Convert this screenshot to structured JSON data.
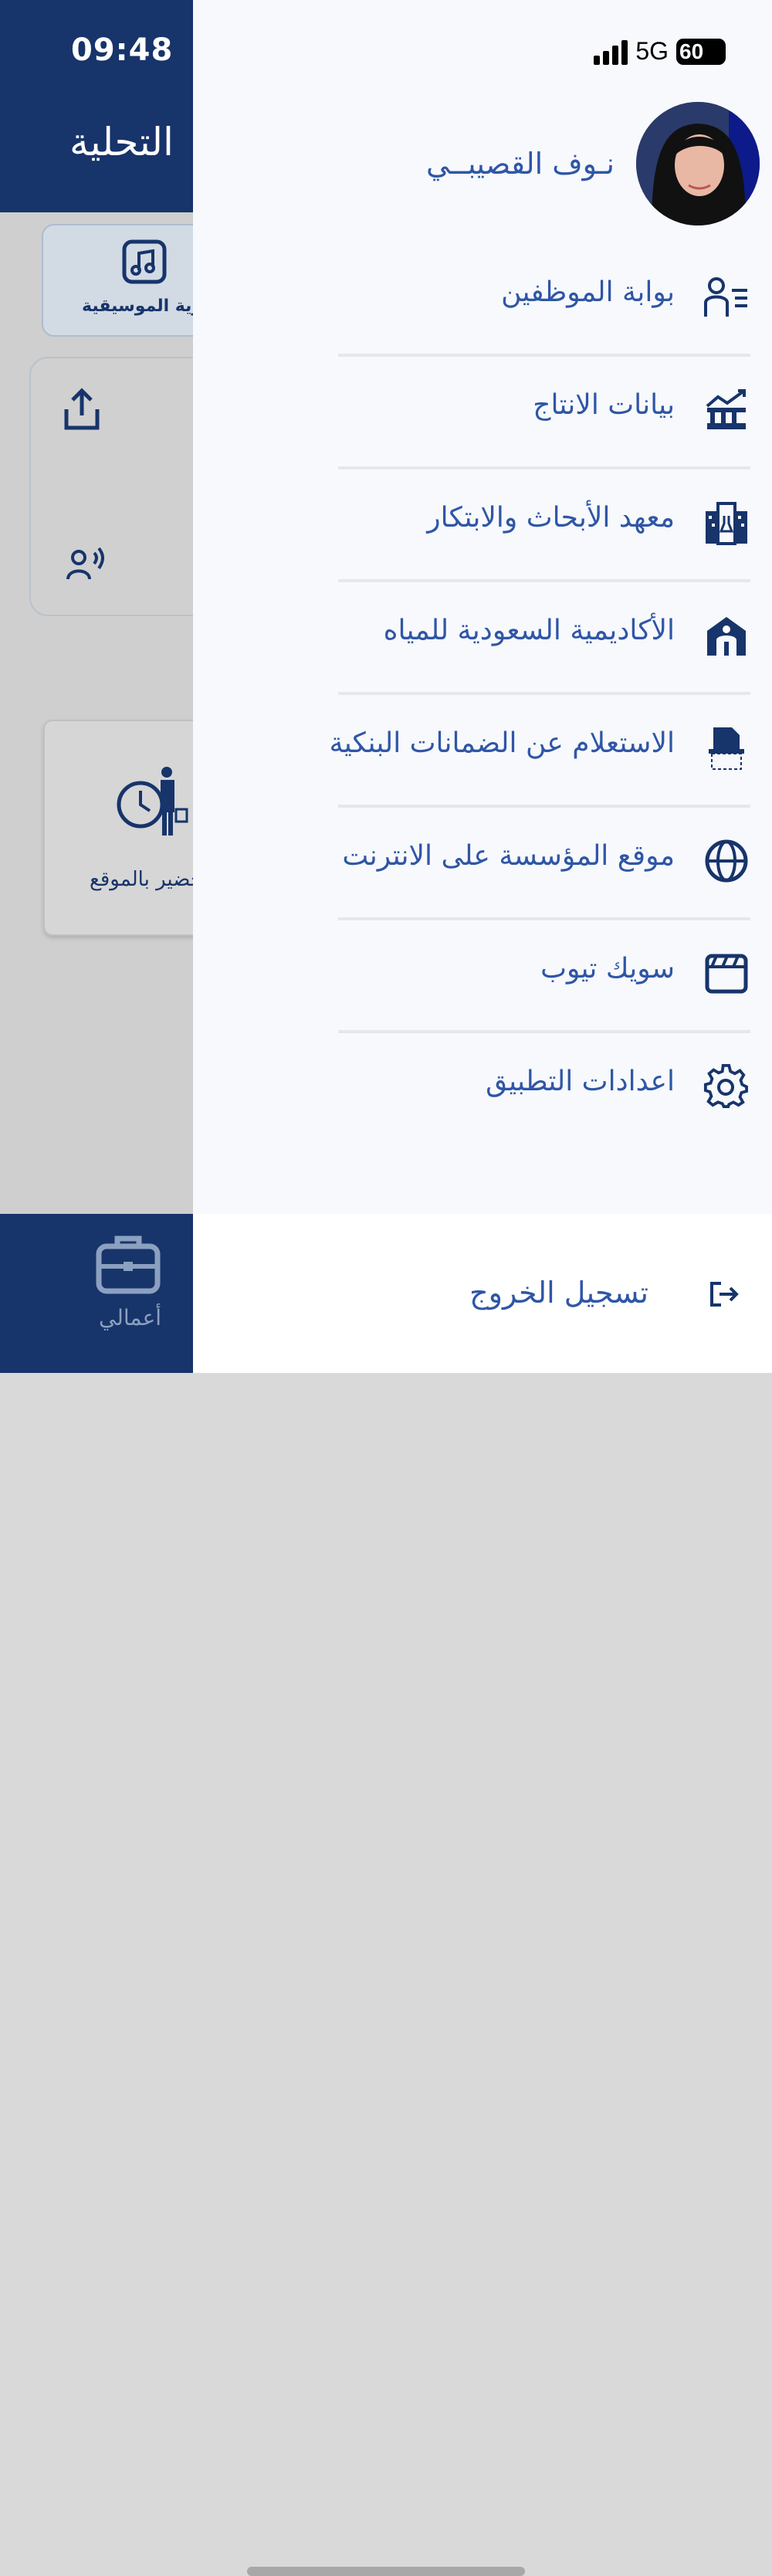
{
  "status_bar": {
    "time": "09:48",
    "network": "5G",
    "battery": "60"
  },
  "background": {
    "header_title": "التحلية",
    "music_card_label": "الهوية الموسيقية",
    "attendance_card_label": "التحضير بالموقع",
    "tab_label": "أعمالي"
  },
  "drawer": {
    "user_name": "نـوف القصيبــي",
    "menu_items": [
      {
        "label": "بوابة الموظفين",
        "icon": "employee-list-icon"
      },
      {
        "label": "بيانات الانتاج",
        "icon": "production-chart-icon"
      },
      {
        "label": "معهد الأبحاث والابتكار",
        "icon": "research-building-icon"
      },
      {
        "label": "الأكاديمية السعودية للمياه",
        "icon": "academy-icon"
      },
      {
        "label": "الاستعلام عن الضمانات البنكية",
        "icon": "document-scan-icon"
      },
      {
        "label": "موقع المؤسسة على الانترنت",
        "icon": "globe-icon"
      },
      {
        "label": "سويك تيوب",
        "icon": "video-clapper-icon"
      },
      {
        "label": "اعدادات التطبيق",
        "icon": "gear-icon"
      }
    ],
    "logout_label": "تسجيل الخروج"
  },
  "colors": {
    "brand_navy": "#17346b",
    "menu_text": "#2f56a6",
    "drawer_bg": "#f7f9fc"
  }
}
